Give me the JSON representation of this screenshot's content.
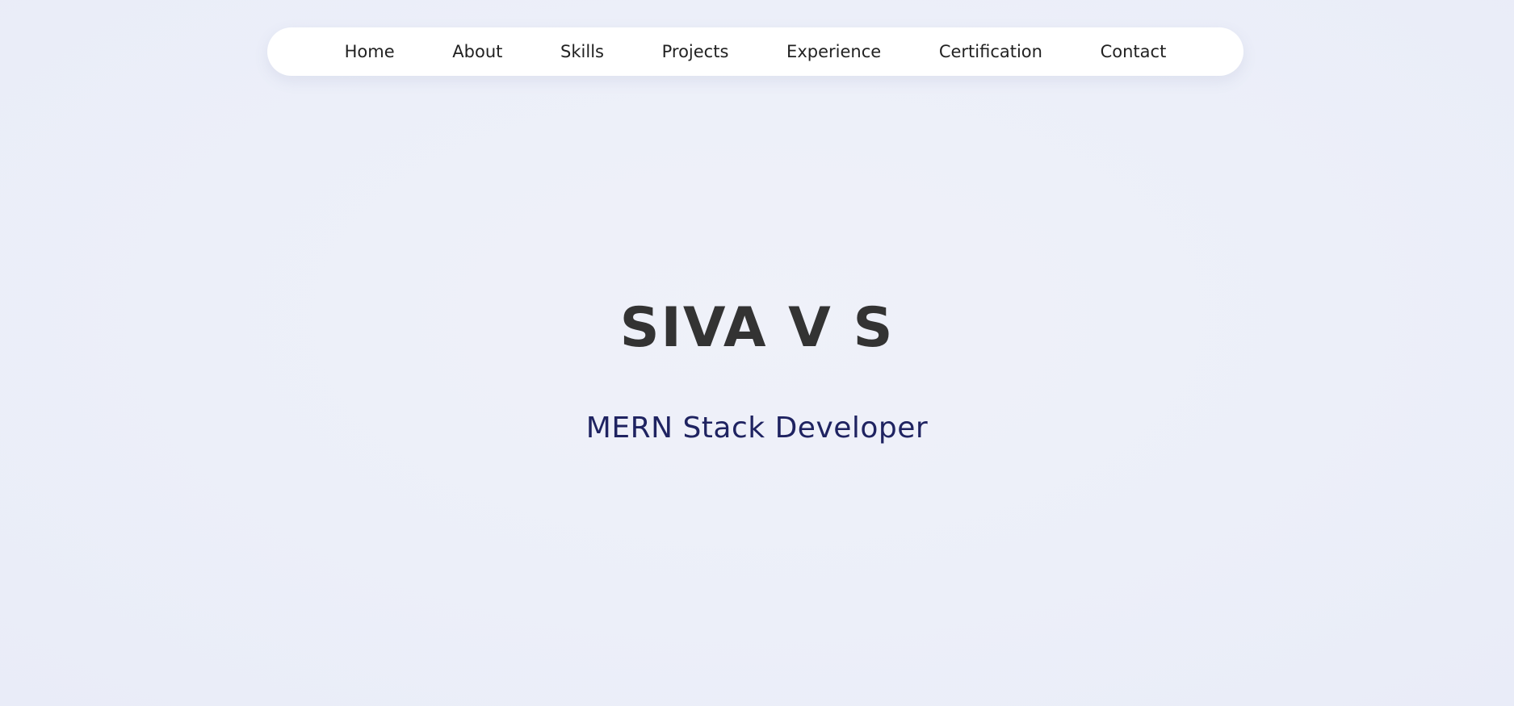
{
  "nav": {
    "items": [
      {
        "label": "Home"
      },
      {
        "label": "About"
      },
      {
        "label": "Skills"
      },
      {
        "label": "Projects"
      },
      {
        "label": "Experience"
      },
      {
        "label": "Certification"
      },
      {
        "label": "Contact"
      }
    ]
  },
  "hero": {
    "name": "SIVA V S",
    "role": "MERN Stack Developer"
  },
  "colors": {
    "background": "#eceff9",
    "nav_background": "#ffffff",
    "nav_text": "#222222",
    "name_text": "#333333",
    "role_text": "#1f2361"
  }
}
